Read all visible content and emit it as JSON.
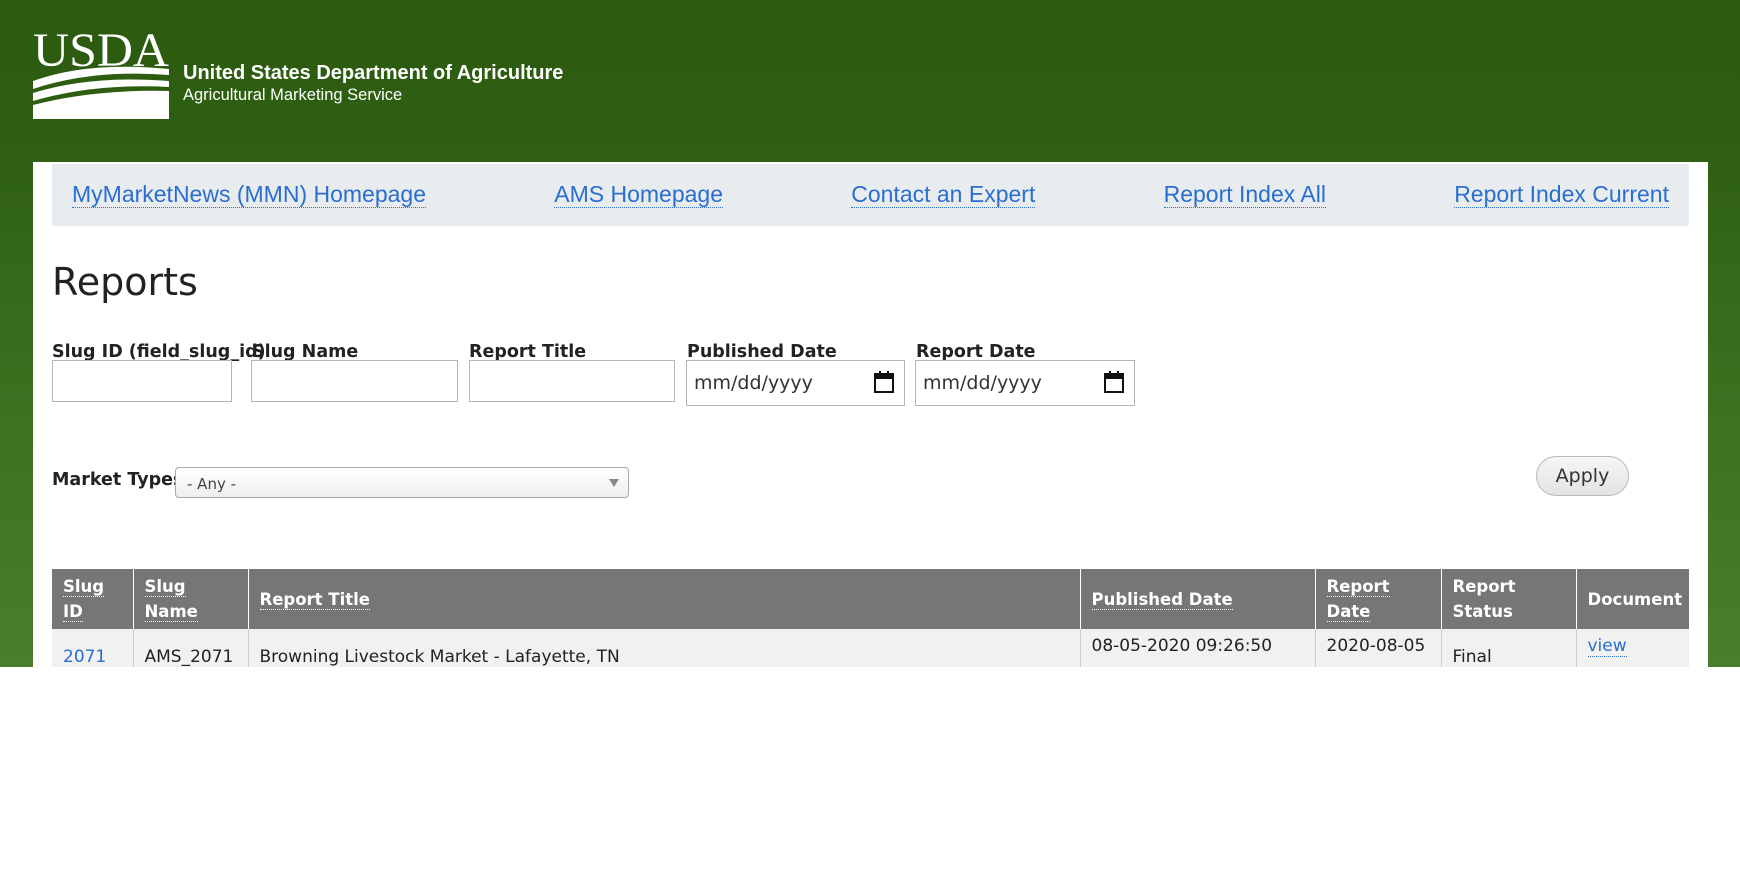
{
  "header": {
    "logo_text": "USDA",
    "agency_name": "United States Department of Agriculture",
    "agency_sub": "Agricultural Marketing Service"
  },
  "nav": {
    "links": [
      "MyMarketNews (MMN) Homepage",
      "AMS Homepage",
      "Contact an Expert",
      "Report Index All",
      "Report Index Current"
    ]
  },
  "page": {
    "title": "Reports"
  },
  "filters": {
    "slug_id": {
      "label": "Slug ID (field_slug_id)",
      "value": ""
    },
    "slug_name": {
      "label": "Slug Name",
      "value": ""
    },
    "report_title": {
      "label": "Report Title",
      "value": ""
    },
    "published_date": {
      "label": "Published Date",
      "placeholder": "mm/dd/yyyy"
    },
    "report_date": {
      "label": "Report Date",
      "placeholder": "mm/dd/yyyy"
    },
    "market_types": {
      "label": "Market Types",
      "selected": "- Any -"
    },
    "apply_label": "Apply"
  },
  "table": {
    "columns": [
      {
        "line1": "Slug",
        "line2": "ID"
      },
      {
        "line1": "Slug",
        "line2": "Name"
      },
      {
        "line1": "Report Title"
      },
      {
        "line1": "Published Date"
      },
      {
        "line1": "Report Date"
      },
      {
        "line1": "Report",
        "line2": "Status"
      },
      {
        "line1": "Document"
      }
    ],
    "rows": [
      {
        "slug_id": "2071",
        "slug_name": "AMS_2071",
        "report_title": "Browning Livestock Market - Lafayette, TN",
        "published_date": "08-05-2020 09:26:50",
        "report_date": "2020-08-05",
        "status": "Final",
        "document": "view"
      }
    ]
  }
}
